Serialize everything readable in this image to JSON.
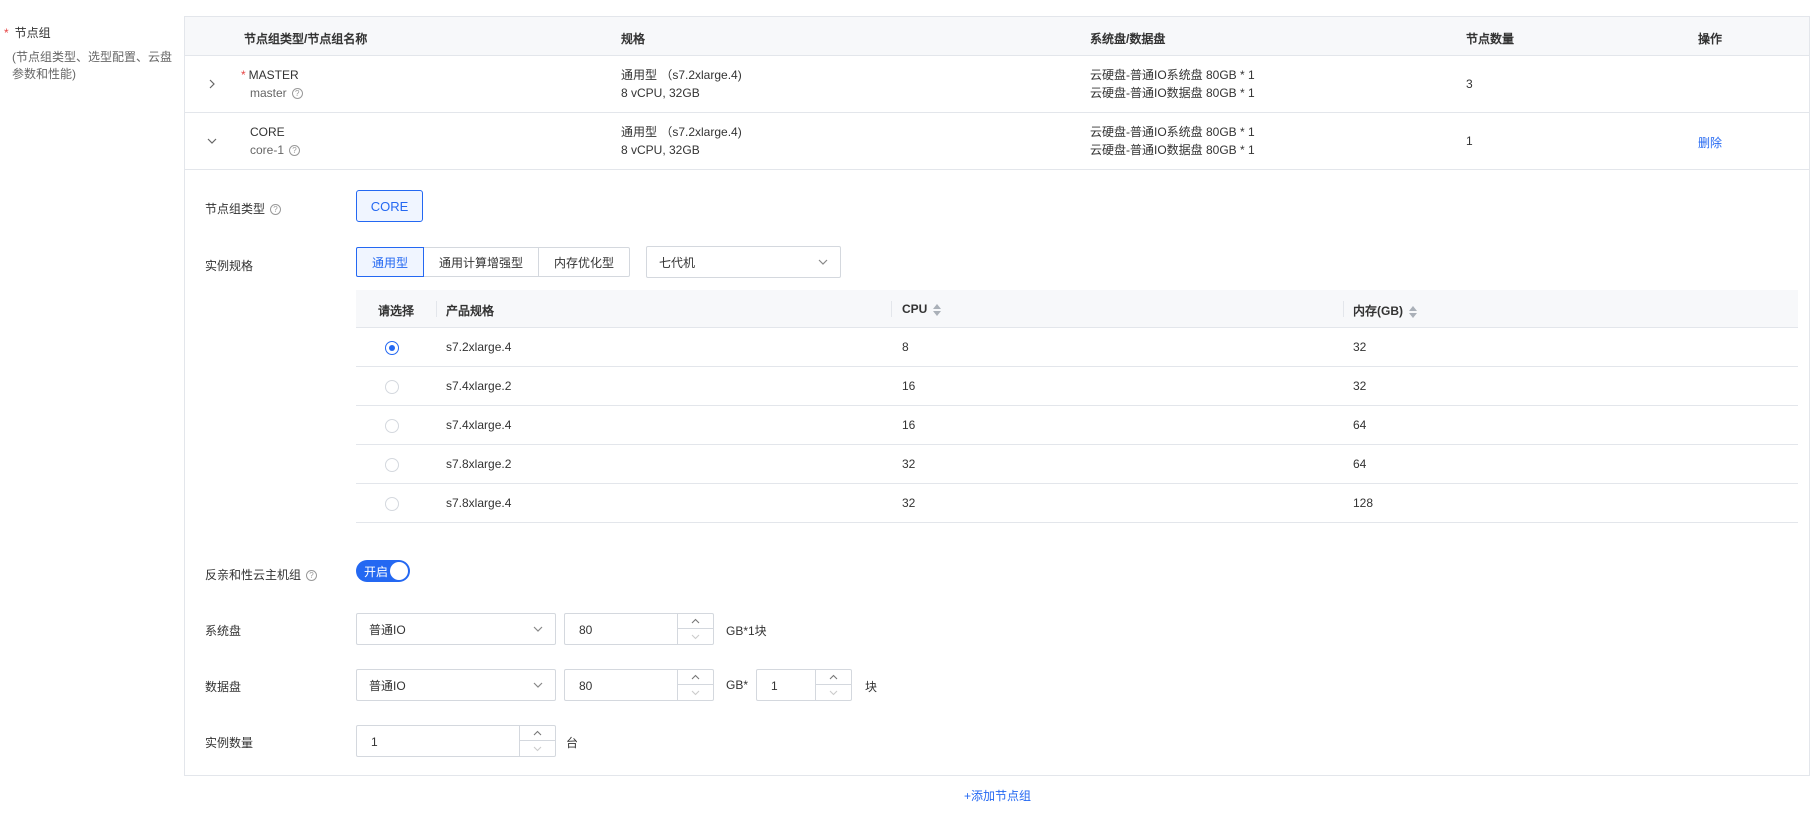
{
  "form": {
    "required_mark": "*",
    "label": "节点组",
    "hint": "(节点组类型、选型配置、云盘参数和性能)"
  },
  "grid": {
    "headers": [
      "节点组类型/节点组名称",
      "规格",
      "系统盘/数据盘",
      "节点数量",
      "操作"
    ],
    "rows": [
      {
        "required_mark": "*",
        "type": "MASTER",
        "name": "master",
        "spec_line1": "通用型 （s7.2xlarge.4)",
        "spec_line2": "8 vCPU, 32GB",
        "disk_line1": "云硬盘-普通IO系统盘 80GB * 1",
        "disk_line2": "云硬盘-普通IO数据盘 80GB * 1",
        "count": "3",
        "action": ""
      },
      {
        "required_mark": "",
        "type": "CORE",
        "name": "core-1",
        "spec_line1": "通用型 （s7.2xlarge.4)",
        "spec_line2": "8 vCPU, 32GB",
        "disk_line1": "云硬盘-普通IO系统盘 80GB * 1",
        "disk_line2": "云硬盘-普通IO数据盘 80GB * 1",
        "count": "1",
        "action": "删除"
      }
    ]
  },
  "detail": {
    "node_type_label": "节点组类型",
    "node_type_value": "CORE",
    "instance_spec_label": "实例规格",
    "spec_tabs": [
      "通用型",
      "通用计算增强型",
      "内存优化型"
    ],
    "spec_tab_selected": "通用型",
    "generation_select": "七代机",
    "spec_table": {
      "headers": [
        "请选择",
        "产品规格",
        "CPU",
        "内存(GB)"
      ],
      "rows": [
        {
          "selected": true,
          "name": "s7.2xlarge.4",
          "cpu": "8",
          "mem": "32"
        },
        {
          "selected": false,
          "name": "s7.4xlarge.2",
          "cpu": "16",
          "mem": "32"
        },
        {
          "selected": false,
          "name": "s7.4xlarge.4",
          "cpu": "16",
          "mem": "64"
        },
        {
          "selected": false,
          "name": "s7.8xlarge.2",
          "cpu": "32",
          "mem": "64"
        },
        {
          "selected": false,
          "name": "s7.8xlarge.4",
          "cpu": "32",
          "mem": "128"
        }
      ]
    },
    "anti_affinity_label": "反亲和性云主机组",
    "anti_affinity_toggle": "开启",
    "system_disk_label": "系统盘",
    "system_disk_type": "普通IO",
    "system_disk_size": "80",
    "system_disk_unit": "GB*1块",
    "data_disk_label": "数据盘",
    "data_disk_type": "普通IO",
    "data_disk_size": "80",
    "data_disk_unit": "GB*",
    "data_disk_count": "1",
    "data_disk_count_unit": "块",
    "instance_count_label": "实例数量",
    "instance_count": "1",
    "instance_count_unit": "台"
  },
  "add_group_link": "+添加节点组",
  "colors": {
    "primary": "#2468f2",
    "required": "#e64545",
    "border": "#e3e6eb"
  }
}
